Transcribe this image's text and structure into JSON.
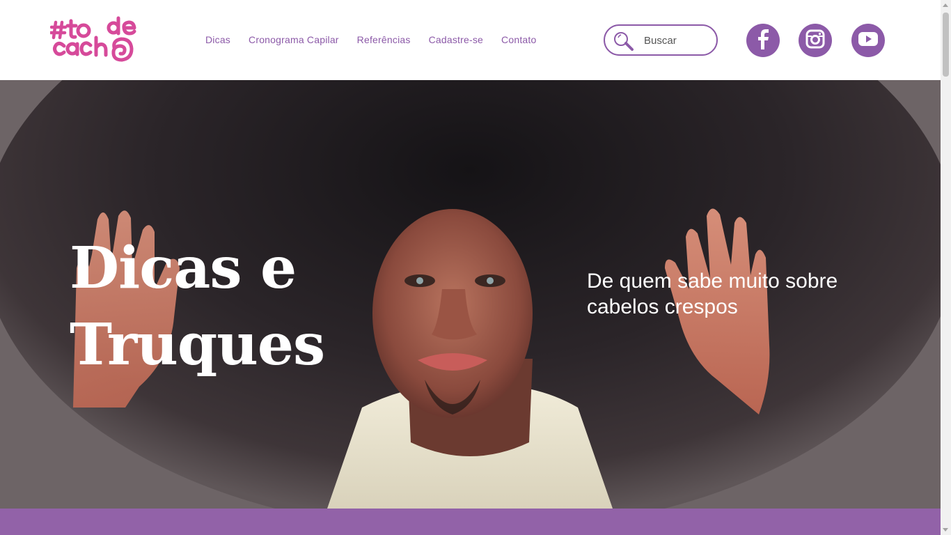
{
  "brand": {
    "logo_text": "#to de cacho",
    "logo_color": "#d64a9a"
  },
  "nav": {
    "items": [
      {
        "label": "Dicas"
      },
      {
        "label": "Cronograma Capilar"
      },
      {
        "label": "Referências"
      },
      {
        "label": "Cadastre-se"
      },
      {
        "label": "Contato"
      }
    ]
  },
  "search": {
    "placeholder": "Buscar",
    "icon": "search-icon"
  },
  "social": [
    {
      "name": "facebook",
      "icon": "facebook-icon"
    },
    {
      "name": "instagram",
      "icon": "instagram-icon"
    },
    {
      "name": "youtube",
      "icon": "youtube-icon"
    }
  ],
  "hero": {
    "title_line1": "Dicas e",
    "title_line2": "Truques",
    "subtitle": "De quem sabe muito sobre cabelos crespos"
  },
  "colors": {
    "accent": "#8c5aa8",
    "band": "#9262a8",
    "logo": "#d64a9a"
  }
}
